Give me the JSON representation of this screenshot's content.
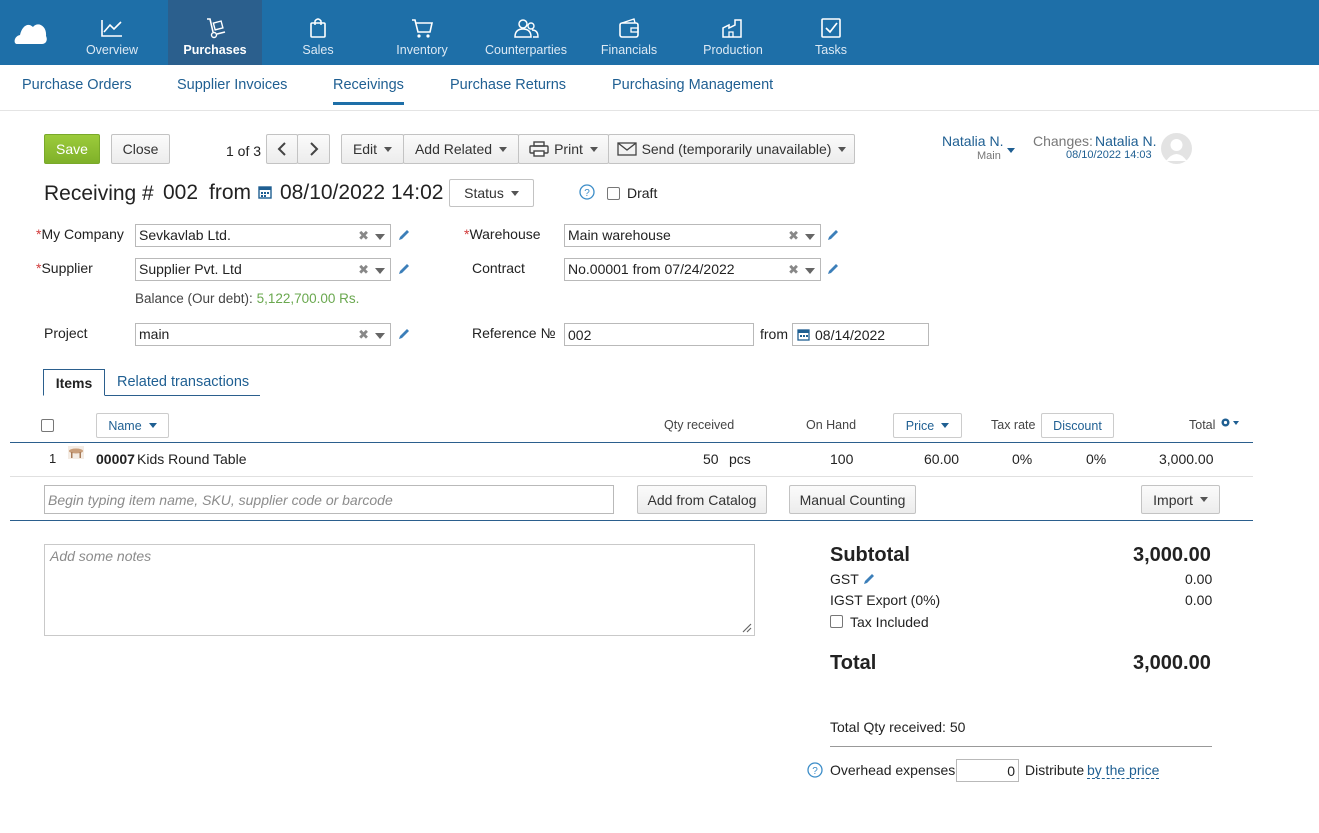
{
  "nav": {
    "items": [
      {
        "label": "Overview",
        "icon": "chart-line-icon"
      },
      {
        "label": "Purchases",
        "icon": "hand-truck-icon"
      },
      {
        "label": "Sales",
        "icon": "shopping-bag-icon"
      },
      {
        "label": "Inventory",
        "icon": "cart-icon"
      },
      {
        "label": "Counterparties",
        "icon": "people-icon"
      },
      {
        "label": "Financials",
        "icon": "wallet-icon"
      },
      {
        "label": "Production",
        "icon": "factory-icon"
      },
      {
        "label": "Tasks",
        "icon": "checkbox-icon"
      }
    ],
    "active": "Purchases"
  },
  "subnav": {
    "items": [
      "Purchase Orders",
      "Supplier Invoices",
      "Receivings",
      "Purchase Returns",
      "Purchasing Management"
    ],
    "active": "Receivings"
  },
  "toolbar": {
    "save": "Save",
    "close": "Close",
    "pager": "1 of 3",
    "edit": "Edit",
    "add_related": "Add Related",
    "print": "Print",
    "send": "Send (temporarily unavailable)"
  },
  "user": {
    "name": "Natalia N.",
    "role": "Main",
    "changes_label": "Changes:",
    "changes_user": "Natalia N.",
    "changes_date": "08/10/2022 14:03"
  },
  "doc": {
    "title": "Receiving #",
    "number": "002",
    "from": "from",
    "date": "08/10/2022 14:02",
    "status": "Status",
    "draft": "Draft"
  },
  "form": {
    "company_label": "My Company",
    "company": "Sevkavlab Ltd.",
    "supplier_label": "Supplier",
    "supplier": "Supplier Pvt. Ltd",
    "balance_label": "Balance (Our debt):",
    "balance_value": "5,122,700.00 Rs.",
    "project_label": "Project",
    "project": "main",
    "warehouse_label": "Warehouse",
    "warehouse": "Main warehouse",
    "contract_label": "Contract",
    "contract": "No.00001 from 07/24/2022",
    "reference_label": "Reference №",
    "reference": "002",
    "reference_from": "from",
    "reference_date": "08/14/2022"
  },
  "tabs": [
    "Items",
    "Related transactions"
  ],
  "table": {
    "headers": {
      "name": "Name",
      "qty": "Qty received",
      "onhand": "On Hand",
      "price": "Price",
      "tax": "Tax rate",
      "discount": "Discount",
      "total": "Total"
    },
    "rows": [
      {
        "num": "1",
        "code": "00007",
        "name": "Kids Round Table",
        "qty": "50",
        "unit": "pcs",
        "onhand": "100",
        "price": "60.00",
        "tax": "0%",
        "discount": "0%",
        "total": "3,000.00"
      }
    ],
    "search_placeholder": "Begin typing item name, SKU, supplier code or barcode",
    "add_catalog": "Add from Catalog",
    "manual": "Manual Counting",
    "import": "Import"
  },
  "notes_placeholder": "Add some notes",
  "summary": {
    "subtotal_label": "Subtotal",
    "subtotal": "3,000.00",
    "gst_label": "GST",
    "gst": "0.00",
    "igst_label": "IGST Export (0%)",
    "igst": "0.00",
    "tax_included": "Tax Included",
    "total_label": "Total",
    "total": "3,000.00",
    "total_qty": "Total Qty received: 50",
    "overhead_label": "Overhead expenses",
    "overhead_value": "0",
    "distribute_label": "Distribute",
    "distribute_link": "by the price"
  },
  "colors": {
    "nav_bg": "#1e6fa8",
    "save_green": "#8bbd32",
    "link_blue": "#1f5f92",
    "balance_green": "#6aa84f"
  }
}
